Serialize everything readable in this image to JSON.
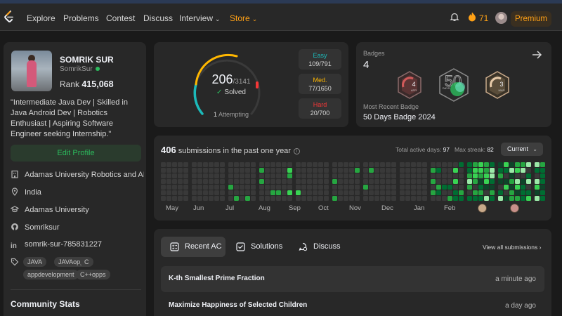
{
  "nav": {
    "items": [
      "Explore",
      "Problems",
      "Contest",
      "Discuss",
      "Interview",
      "Store"
    ],
    "streak": "71",
    "premium": "Premium",
    "accent": "#ffa116"
  },
  "profile": {
    "name": "SOMRIK SUR",
    "username": "SomrikSur",
    "rank_label": "Rank",
    "rank": "415,068",
    "bio": "\"Intermediate Java Dev | Skilled in Java Android Dev | Robotics Enthusiast | Aspiring Software Engineer seeking Internship.\"",
    "edit": "Edit Profile",
    "info": [
      {
        "icon": "building-icon",
        "text": "Adamas University Robotics and AI Cl..."
      },
      {
        "icon": "location-icon",
        "text": "India"
      },
      {
        "icon": "graduation-cap-icon",
        "text": "Adamas University"
      },
      {
        "icon": "github-icon",
        "text": "Somriksur"
      },
      {
        "icon": "linkedin-icon",
        "text": "somrik-sur-785831227"
      }
    ],
    "tags": [
      "JAVA",
      "JAVAopps",
      "C",
      "appdevelopment",
      "C++opps"
    ],
    "community": "Community Stats"
  },
  "solved": {
    "count": "206",
    "total": "/3141",
    "label": "Solved",
    "attempting_count": "1",
    "attempting_label": "Attempting",
    "difficulty": [
      {
        "label": "Easy",
        "value": "109/791",
        "color": "#1cbaba"
      },
      {
        "label": "Med.",
        "value": "77/1650",
        "color": "#ffb700"
      },
      {
        "label": "Hard",
        "value": "20/700",
        "color": "#f63737"
      }
    ]
  },
  "badges": {
    "label": "Badges",
    "count": "4",
    "items": [
      {
        "name": "APR",
        "number": "4"
      },
      {
        "name": "DAYS",
        "number": "50"
      },
      {
        "name": "MAR",
        "number": "3"
      }
    ],
    "recent_label": "Most Recent Badge",
    "recent": "50 Days Badge 2024"
  },
  "submissions": {
    "count": "406",
    "text": "submissions in the past one year",
    "active_label": "Total active days:",
    "active": "97",
    "streak_label": "Max streak:",
    "streak": "82",
    "period": "Current",
    "months": [
      "May",
      "Jun",
      "Jul",
      "Aug",
      "Sep",
      "Oct",
      "Nov",
      "Dec",
      "Jan",
      "Feb",
      "Mar",
      "Apr"
    ]
  },
  "recent": {
    "tabs": [
      "Recent AC",
      "Solutions",
      "Discuss"
    ],
    "view_all": "View all submissions",
    "rows": [
      {
        "title": "K-th Smallest Prime Fraction",
        "time": "a minute ago"
      },
      {
        "title": "Maximize Happiness of Selected Children",
        "time": "a day ago"
      }
    ]
  }
}
